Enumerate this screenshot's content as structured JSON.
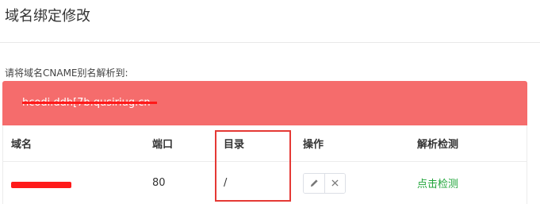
{
  "page": {
    "title": "域名绑定修改"
  },
  "hint": "请将域名CNAME别名解析到:",
  "banner": {
    "cname_value": "hcodi.ddh[7b.qusiriug.cn",
    "background": "#f56c6c"
  },
  "table": {
    "headers": [
      "域名",
      "端口",
      "目录",
      "操作",
      "解析检测"
    ],
    "rows": [
      {
        "domain": "",
        "port": "80",
        "directory": "/",
        "check_label": "点击检测"
      }
    ]
  },
  "icons": {
    "edit": "pencil-icon",
    "delete": "close-icon"
  },
  "colors": {
    "accent_green": "#20a53a",
    "annotation_red": "#e53935"
  }
}
